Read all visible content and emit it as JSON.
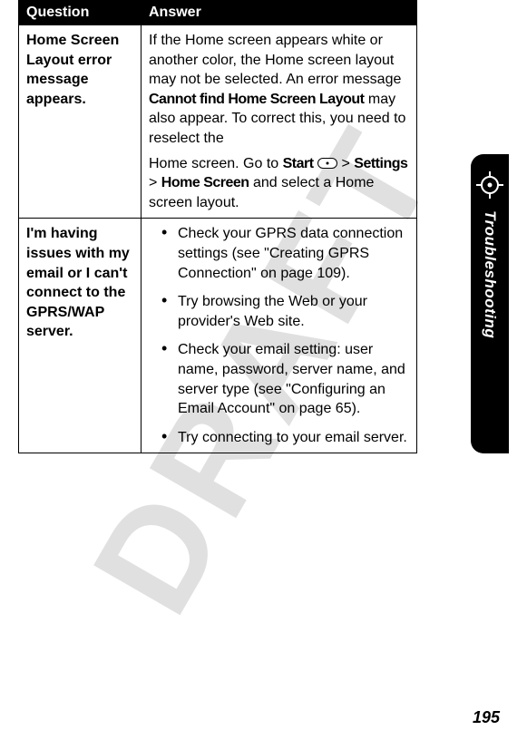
{
  "watermark": "DRAFT",
  "table": {
    "headers": {
      "q": "Question",
      "a": "Answer"
    },
    "rows": [
      {
        "question": "Home Screen Layout error message appears.",
        "answer_p1_a": "If the Home screen appears white or another color, the Home screen layout may not be selected. An error message ",
        "answer_p1_bold": "Cannot find Home Screen Layout",
        "answer_p1_b": " may also appear. To correct this, you need to reselect the",
        "answer_p2_a": "Home screen. Go to ",
        "answer_p2_bold1": "Start",
        "answer_p2_b": " ",
        "answer_p2_c": " > ",
        "answer_p2_bold2": "Settings",
        "answer_p2_d": " > ",
        "answer_p2_bold3": "Home Screen",
        "answer_p2_e": " and select a Home screen layout."
      },
      {
        "question": "I'm having issues with my email or I can't connect to the GPRS/WAP server.",
        "bullets": [
          "Check your GPRS data connection settings (see \"Creating GPRS Connection\" on page 109).",
          "Try browsing the Web or your provider's Web site.",
          "Check your email setting: user name, password, server name, and server type (see \"Configuring an Email Account\" on page 65).",
          "Try connecting to your email server."
        ]
      }
    ]
  },
  "sidetab_label": "Troubleshooting",
  "page_number": "195"
}
